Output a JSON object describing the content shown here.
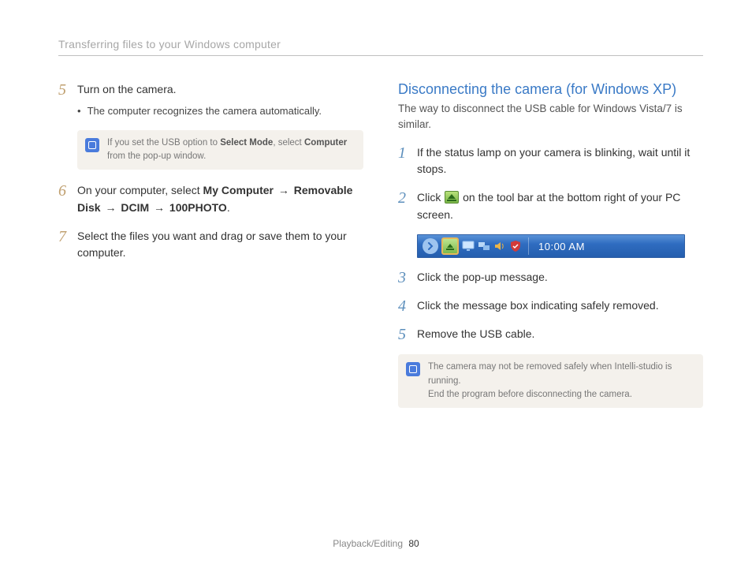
{
  "header": {
    "title": "Transferring files to your Windows computer"
  },
  "left": {
    "steps": [
      {
        "num": "5",
        "text": "Turn on the camera.",
        "bullet": "The computer recognizes the camera automatically."
      },
      {
        "num": "6",
        "parts": [
          "On your computer, select ",
          "My Computer",
          " → ",
          "Removable Disk",
          " → ",
          "DCIM",
          " → ",
          "100PHOTO",
          "."
        ]
      },
      {
        "num": "7",
        "text": "Select the files you want and drag or save them to your computer."
      }
    ],
    "note": {
      "parts": [
        "If you set the USB option to ",
        "Select Mode",
        ", select ",
        "Computer",
        " from the pop-up window."
      ]
    }
  },
  "right": {
    "heading": "Disconnecting the camera (for Windows XP)",
    "sub": "The way to disconnect the USB cable for Windows Vista/7 is similar.",
    "steps": [
      {
        "num": "1",
        "text": "If the status lamp on your camera is blinking, wait until it stops."
      },
      {
        "num": "2",
        "pre": "Click ",
        "post": " on the tool bar at the bottom right of your PC screen."
      },
      {
        "num": "3",
        "text": "Click the pop-up message."
      },
      {
        "num": "4",
        "text": "Click the message box indicating safely removed."
      },
      {
        "num": "5",
        "text": "Remove the USB cable."
      }
    ],
    "taskbar": {
      "clock": "10:00 AM",
      "icons": [
        "safely-remove",
        "display",
        "network",
        "volume",
        "shield"
      ]
    },
    "note": {
      "line1": "The camera may not be removed safely when Intelli-studio is running.",
      "line2": "End the program before disconnecting the camera."
    }
  },
  "footer": {
    "section": "Playback/Editing",
    "page": "80"
  }
}
